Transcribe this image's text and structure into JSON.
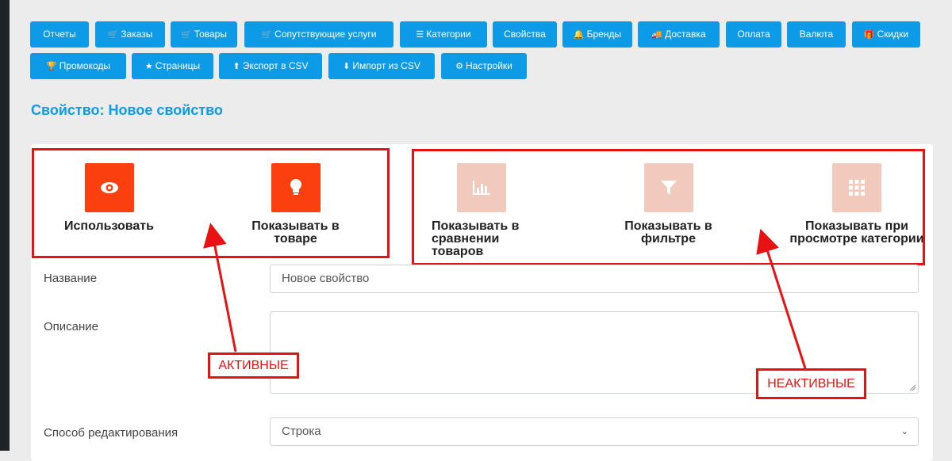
{
  "nav": {
    "row1": [
      {
        "label": "Отчеты",
        "icon": ""
      },
      {
        "label": "Заказы",
        "icon": "cart-icon"
      },
      {
        "label": "Товары",
        "icon": "cart-icon"
      },
      {
        "label": "Сопутствующие услуги",
        "icon": "cart-plus-icon"
      },
      {
        "label": "Категории",
        "icon": "list-icon"
      },
      {
        "label": "Свойства",
        "icon": ""
      },
      {
        "label": "Бренды",
        "icon": "bell-icon"
      },
      {
        "label": "Доставка",
        "icon": "truck-icon"
      },
      {
        "label": "Оплата",
        "icon": ""
      },
      {
        "label": "Валюта",
        "icon": ""
      },
      {
        "label": "Скидки",
        "icon": "gift-icon"
      }
    ],
    "row2": [
      {
        "label": "Промокоды",
        "icon": "trophy-icon"
      },
      {
        "label": "Страницы",
        "icon": "star-icon"
      },
      {
        "label": "Экспорт в CSV",
        "icon": "upload-icon"
      },
      {
        "label": "Импорт из CSV",
        "icon": "download-icon"
      },
      {
        "label": "Настройки",
        "icon": "gear-icon"
      }
    ]
  },
  "page": {
    "title": "Свойство: Новое свойство"
  },
  "toggles": [
    {
      "label": "Использовать",
      "icon": "eye-icon",
      "state": "active"
    },
    {
      "label": "Показывать в товаре",
      "icon": "lightbulb-icon",
      "state": "active"
    },
    {
      "label": "Показывать в сравнении товаров",
      "icon": "bar-chart-icon",
      "state": "inactive"
    },
    {
      "label": "Показывать в фильтре",
      "icon": "filter-icon",
      "state": "inactive"
    },
    {
      "label": "Показывать при просмотре категории",
      "icon": "grid-icon",
      "state": "inactive"
    }
  ],
  "form": {
    "name_label": "Название",
    "name_value": "Новое свойство",
    "description_label": "Описание",
    "description_value": "",
    "edit_mode_label": "Способ редактирования",
    "edit_mode_value": "Строка"
  },
  "annotations": {
    "active": "АКТИВНЫЕ",
    "inactive": "НЕАКТИВНЫЕ"
  },
  "colors": {
    "nav_button": "#0d9ae6",
    "title": "#0d9ae6",
    "toggle_active": "#fb3f0f",
    "toggle_inactive": "#f1c9bd",
    "annotation": "#e81212"
  }
}
